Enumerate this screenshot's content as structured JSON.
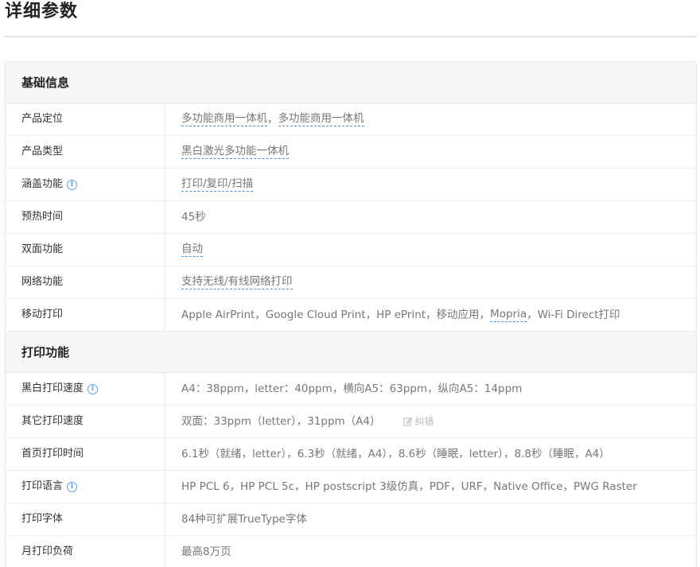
{
  "page_title": "详细参数",
  "sections": [
    {
      "title": "基础信息",
      "rows": [
        {
          "label": "产品定位",
          "info": false,
          "value": "",
          "links": [
            "多功能商用一体机",
            "多功能商用一体机"
          ],
          "separator": "，"
        },
        {
          "label": "产品类型",
          "info": false,
          "links": [
            "黑白激光多功能一体机"
          ]
        },
        {
          "label": "涵盖功能",
          "info": true,
          "links": [
            "打印/复印/扫描"
          ]
        },
        {
          "label": "预热时间",
          "info": false,
          "value": "45秒"
        },
        {
          "label": "双面功能",
          "info": false,
          "links": [
            "自动"
          ]
        },
        {
          "label": "网络功能",
          "info": false,
          "links": [
            "支持无线/有线网络打印"
          ]
        },
        {
          "label": "移动打印",
          "info": false,
          "value_prefix": "Apple AirPrint，Google Cloud Print，HP ePrint，移动应用，",
          "link": "Mopria",
          "value_suffix": "，Wi-Fi Direct打印"
        }
      ]
    },
    {
      "title": "打印功能",
      "rows": [
        {
          "label": "黑白打印速度",
          "info": true,
          "value": "A4：38ppm，letter：40ppm，横向A5：63ppm，纵向A5：14ppm"
        },
        {
          "label": "其它打印速度",
          "info": false,
          "value": "双面：33ppm（letter），31ppm（A4）",
          "action": "纠错"
        },
        {
          "label": "首页打印时间",
          "info": false,
          "value": "6.1秒（就绪，letter），6.3秒（就绪，A4），8.6秒（睡眠，letter），8.8秒（睡眠，A4）"
        },
        {
          "label": "打印语言",
          "info": true,
          "value": "HP PCL 6，HP PCL 5c，HP postscript 3级仿真，PDF，URF，Native Office，PWG Raster"
        },
        {
          "label": "打印字体",
          "info": false,
          "value": "84种可扩展TrueType字体"
        },
        {
          "label": "月打印负荷",
          "info": false,
          "value": "最高8万页"
        }
      ]
    }
  ],
  "icons": {
    "info": "info-icon",
    "edit": "edit-icon"
  },
  "colors": {
    "link_underline": "#4a90d9",
    "info_icon": "#5a9ee6",
    "section_bg": "#f6f6f6"
  }
}
